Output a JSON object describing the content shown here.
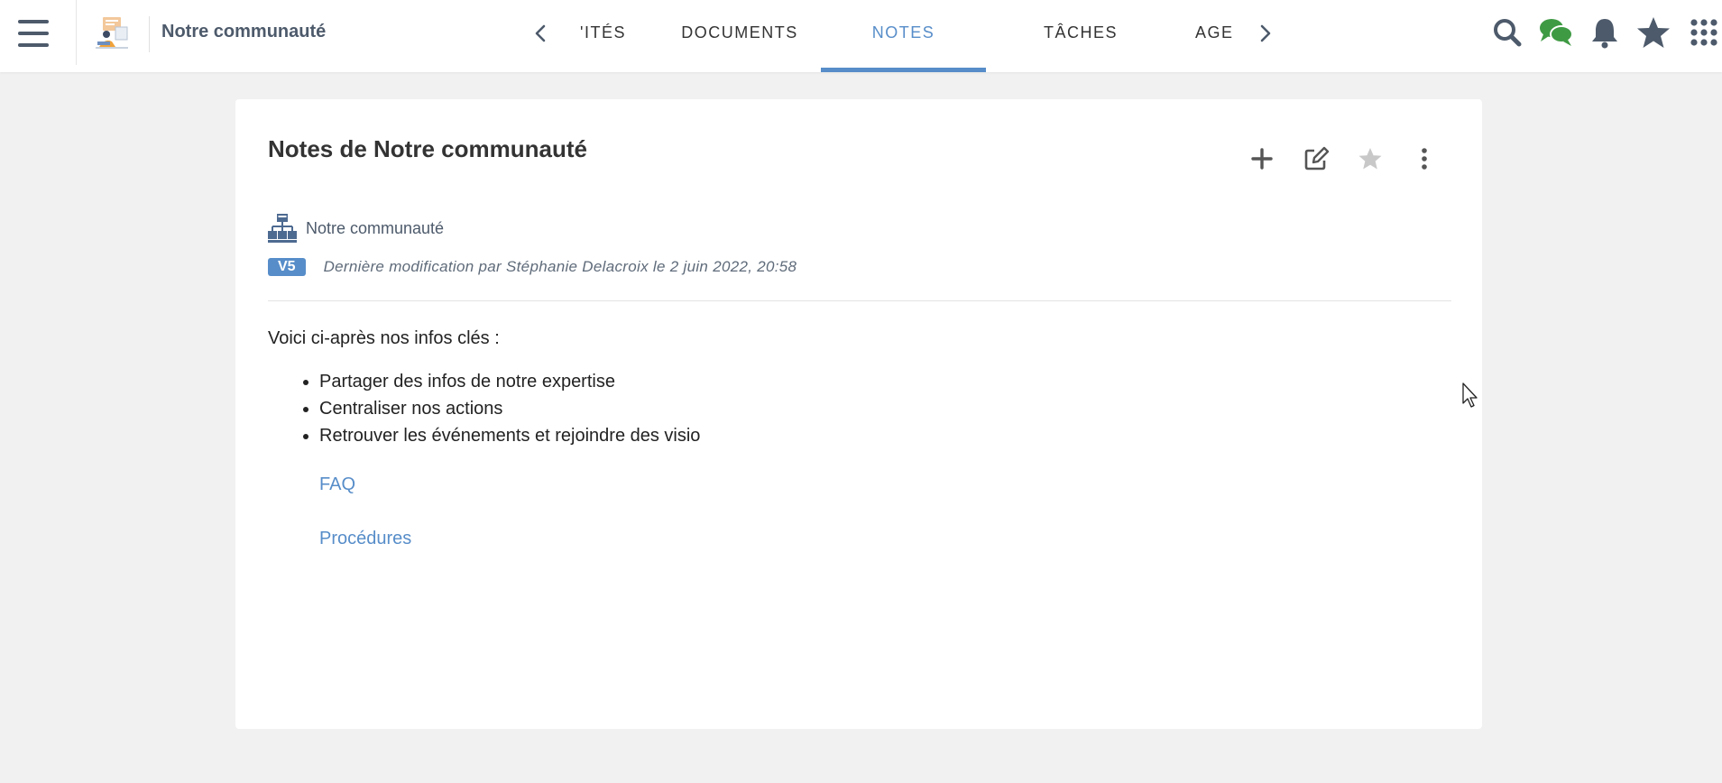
{
  "topbar": {
    "space_name": "Notre communauté",
    "tabs": [
      {
        "label": "'ITÉS"
      },
      {
        "label": "DOCUMENTS"
      },
      {
        "label": "NOTES"
      },
      {
        "label": "TÂCHES"
      },
      {
        "label": "AGE"
      }
    ],
    "active_tab": "NOTES",
    "icons": [
      "search-icon",
      "chat-icon",
      "bell-icon",
      "star-icon",
      "apps-grid-icon"
    ]
  },
  "card": {
    "title": "Notes de Notre communauté",
    "actions": [
      "add-icon",
      "edit-icon",
      "favorite-star-icon",
      "more-vertical-icon"
    ],
    "breadcrumb_label": "Notre communauté",
    "version": "V5",
    "last_modified": "Dernière modification par Stéphanie Delacroix le 2 juin 2022, 20:58"
  },
  "note": {
    "intro": "Voici ci-après nos infos clés :",
    "items": [
      "Partager des infos de notre expertise",
      "Centraliser nos actions",
      "Retrouver les événements et rejoindre des visio"
    ],
    "links": [
      "FAQ",
      "Procédures"
    ]
  },
  "colors": {
    "accent": "#578dc9",
    "nav_icon": "#4d5a6b",
    "chat_green": "#3f9a44",
    "background": "#f1f1f1"
  }
}
